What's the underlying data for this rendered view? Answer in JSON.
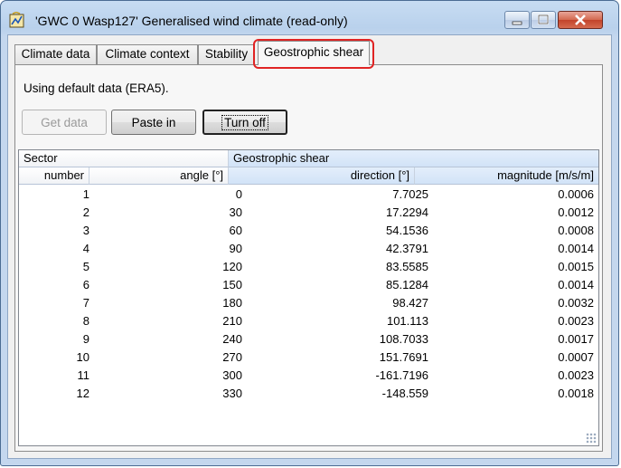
{
  "window": {
    "title": "'GWC 0 Wasp127' Generalised wind climate (read-only)",
    "icon": "wind-climate-app-icon",
    "controls": [
      "minimize-icon",
      "maximize-icon",
      "close-icon"
    ]
  },
  "tabs": [
    {
      "label": "Climate data",
      "active": false
    },
    {
      "label": "Climate context",
      "active": false
    },
    {
      "label": "Stability",
      "active": false
    },
    {
      "label": "Geostrophic shear",
      "active": true
    }
  ],
  "panel": {
    "status_text": "Using default data (ERA5).",
    "buttons": {
      "get_data": "Get data",
      "paste_in": "Paste in",
      "turn_off": "Turn off"
    }
  },
  "table": {
    "group_headers": {
      "sector": "Sector",
      "shear": "Geostrophic shear"
    },
    "columns": [
      "number",
      "angle [°]",
      "direction [°]",
      "magnitude [m/s/m]"
    ],
    "rows": [
      [
        "1",
        "0",
        "7.7025",
        "0.0006"
      ],
      [
        "2",
        "30",
        "17.2294",
        "0.0012"
      ],
      [
        "3",
        "60",
        "54.1536",
        "0.0008"
      ],
      [
        "4",
        "90",
        "42.3791",
        "0.0014"
      ],
      [
        "5",
        "120",
        "83.5585",
        "0.0015"
      ],
      [
        "6",
        "150",
        "85.1284",
        "0.0014"
      ],
      [
        "7",
        "180",
        "98.427",
        "0.0032"
      ],
      [
        "8",
        "210",
        "101.113",
        "0.0023"
      ],
      [
        "9",
        "240",
        "108.7033",
        "0.0017"
      ],
      [
        "10",
        "270",
        "151.7691",
        "0.0007"
      ],
      [
        "11",
        "300",
        "-161.7196",
        "0.0023"
      ],
      [
        "12",
        "330",
        "-148.559",
        "0.0018"
      ]
    ]
  },
  "colors": {
    "highlight_box": "#e02424",
    "header_selected": "#d2e3f7"
  }
}
